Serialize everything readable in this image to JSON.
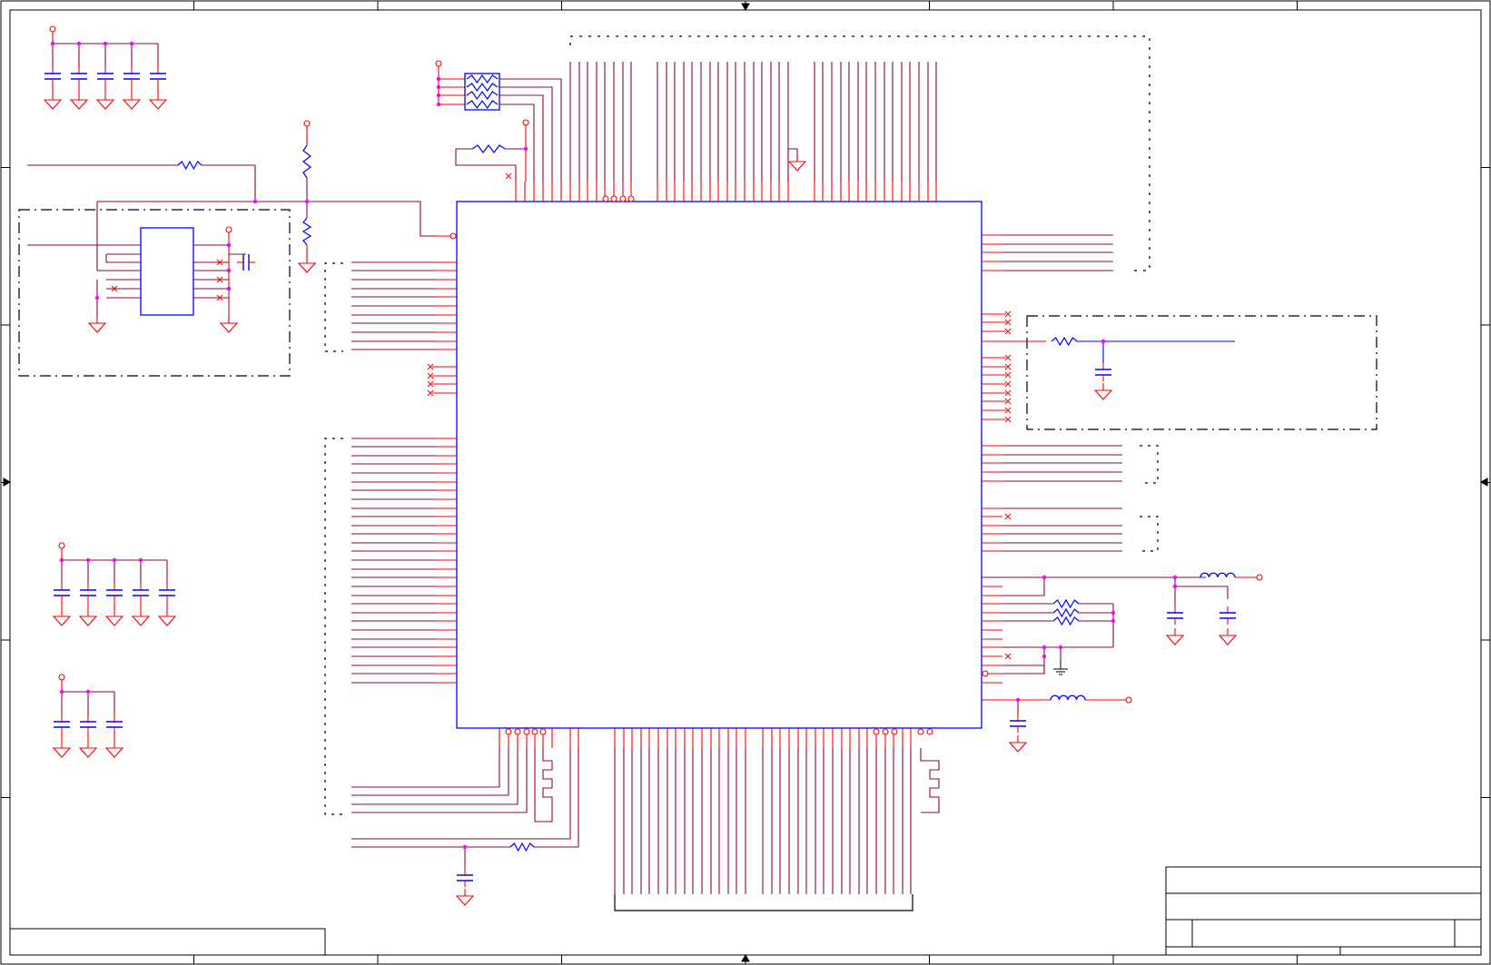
{
  "sheet": {
    "zone_columns": 8,
    "zone_rows": 6,
    "colors": {
      "border": "#000000",
      "wire": "#8b0a3a",
      "pin": "#ff0000",
      "component": "#0000ff",
      "junction": "#ff00ff",
      "ground": "#ff0000",
      "power": "#ff0000"
    }
  },
  "main_ic": {
    "left_pin_groups": 3,
    "right_pin_groups": 7,
    "top_bus_pins": 40,
    "bottom_bus_pins": 36
  },
  "decoupling_banks": [
    {
      "id": "top-left",
      "capacitors": 5
    },
    {
      "id": "mid-left",
      "capacitors": 5
    },
    {
      "id": "low-left",
      "capacitors": 3
    }
  ],
  "title_block": {
    "title": "",
    "doc_number": "",
    "revision": "",
    "sheet": ""
  },
  "notes": ""
}
